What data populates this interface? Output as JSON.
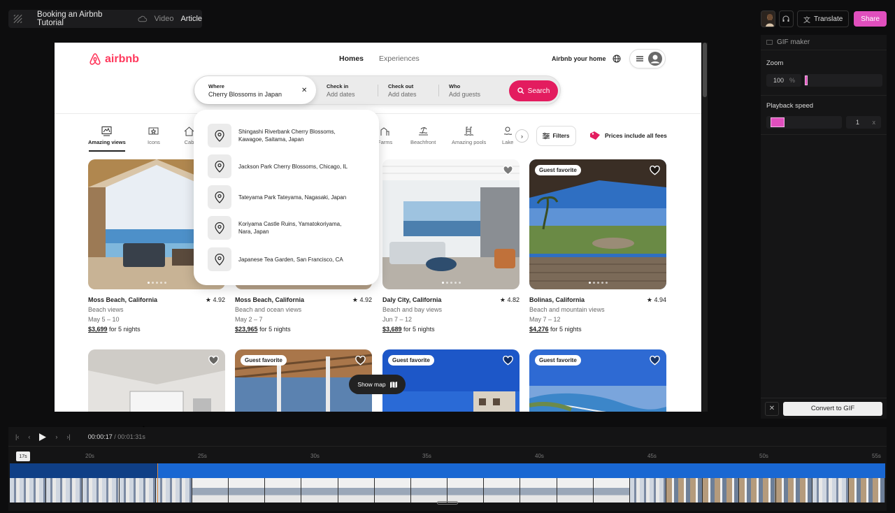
{
  "app": {
    "title": "Booking an Airbnb Tutorial",
    "tabs": [
      "Video",
      "Article"
    ],
    "active_tab": "Article",
    "translate_label": "Translate",
    "share_label": "Share",
    "accent_color": "#e04fbd"
  },
  "panel": {
    "gif_maker_label": "GIF maker",
    "zoom_label": "Zoom",
    "zoom_value": "100",
    "zoom_unit": "%",
    "playback_label": "Playback speed",
    "speed_value": "1",
    "speed_unit": "x",
    "convert_label": "Convert to GIF"
  },
  "airbnb": {
    "brand": "airbnb",
    "nav": [
      "Homes",
      "Experiences"
    ],
    "host_label": "Airbnb your home",
    "search": {
      "where_label": "Where",
      "where_value": "Cherry Blossoms in Japan",
      "checkin_label": "Check in",
      "checkin_value": "Add dates",
      "checkout_label": "Check out",
      "checkout_value": "Add dates",
      "who_label": "Who",
      "who_value": "Add guests",
      "button": "Search"
    },
    "suggestions": [
      "Shingashi Riverbank Cherry Blossoms, Kawagoe, Saitama, Japan",
      "Jackson Park Cherry Blossoms, Chicago, IL",
      "Tateyama Park Tateyama, Nagasaki, Japan",
      "Koriyama Castle Ruins, Yamatokoriyama, Nara, Japan",
      "Japanese Tea Garden, San Francisco, CA"
    ],
    "categories": [
      "Amazing views",
      "Icons",
      "Cab",
      "Farms",
      "Beachfront",
      "Amazing pools",
      "Lake"
    ],
    "filters_label": "Filters",
    "fees_label": "Prices include all fees",
    "listings": [
      {
        "location": "Moss Beach, California",
        "rating": "4.92",
        "desc": "Beach views",
        "dates": "May 5 – 10",
        "price": "$3,699",
        "price_suffix": "for 5 nights",
        "badge": ""
      },
      {
        "location": "Moss Beach, California",
        "rating": "4.92",
        "desc": "Beach and ocean views",
        "dates": "May 2 – 7",
        "price": "$23,965",
        "price_suffix": "for 5 nights",
        "badge": ""
      },
      {
        "location": "Daly City, California",
        "rating": "4.82",
        "desc": "Beach and bay views",
        "dates": "Jun 7 – 12",
        "price": "$3,689",
        "price_suffix": "for 5 nights",
        "badge": ""
      },
      {
        "location": "Bolinas, California",
        "rating": "4.94",
        "desc": "Beach and mountain views",
        "dates": "May 7 – 12",
        "price": "$4,276",
        "price_suffix": "for 5 nights",
        "badge": "Guest favorite"
      }
    ],
    "row2_badges": [
      "",
      "Guest favorite",
      "Guest favorite",
      "Guest favorite"
    ],
    "show_map_label": "Show map"
  },
  "timeline": {
    "current": "00:00:17",
    "separator": "/",
    "total": "00:01:31s",
    "playhead_label": "17s",
    "ticks": [
      "20s",
      "25s",
      "30s",
      "35s",
      "40s",
      "45s",
      "50s",
      "55s"
    ]
  }
}
